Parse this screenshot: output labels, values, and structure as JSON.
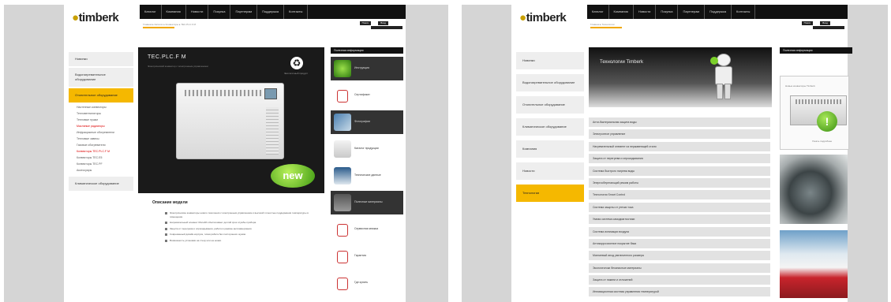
{
  "left_page": {
    "logo": {
      "brand": "timberk"
    },
    "topnav": [
      "Каталог",
      "Компания",
      "Новости",
      "Покупка",
      "Партнерам",
      "Поддержка",
      "Контакты"
    ],
    "breadcrumb": "Главная ▸ Каталог ▸ Конвекторы ▸ TEC.PLC.F M",
    "header_buttons": [
      "Поиск",
      "Вход"
    ],
    "sidebar": {
      "items": [
        {
          "label": "Новинки",
          "active": false
        },
        {
          "label": "Водонагревательное оборудование",
          "active": false
        },
        {
          "label": "Отопительное оборудование",
          "active": true
        }
      ],
      "sub_items": [
        {
          "label": "Настенные конвекторы",
          "red": false
        },
        {
          "label": "Тепловентиляторы",
          "red": false
        },
        {
          "label": "Тепловые пушки",
          "red": false
        },
        {
          "label": "Масляные радиаторы",
          "red": true
        },
        {
          "label": "Инфракрасные обогреватели",
          "red": false
        },
        {
          "label": "Тепловые завесы",
          "red": false
        },
        {
          "label": "Газовые обогреватели",
          "red": false
        },
        {
          "label": "Конвекторы TEC.PLC.F M",
          "red": true
        },
        {
          "label": "Конвекторы TEC.E5",
          "red": false
        },
        {
          "label": "Конвекторы TEC.PF",
          "red": false
        },
        {
          "label": "Аксессуары",
          "red": false
        }
      ],
      "bottom_items": [
        {
          "label": "Климатическое оборудование"
        }
      ]
    },
    "product": {
      "title": "TEC.PLC.F M",
      "subtitle": "Электрический конвектор с электронным управлением",
      "badge": "new",
      "recycle_caption": "Экологичный продукт"
    },
    "right_column": {
      "header": "Полезная информация",
      "items": [
        {
          "label": "Инструкция",
          "dark": true,
          "thumb": "green-guide"
        },
        {
          "label": "Сертификат",
          "dark": false,
          "thumb": "pdf"
        },
        {
          "label": "Фотографии",
          "dark": true,
          "thumb": "photo"
        },
        {
          "label": "Каталог продукции",
          "dark": false,
          "thumb": "heater"
        },
        {
          "label": "Технические данные",
          "dark": false,
          "thumb": "label"
        },
        {
          "label": "Полезные материалы",
          "dark": true,
          "thumb": "book"
        },
        {
          "label": "Сервисная книжка",
          "dark": false,
          "thumb": "pdf"
        },
        {
          "label": "Гарантия",
          "dark": false,
          "thumb": "pdf"
        },
        {
          "label": "Где купить",
          "dark": false,
          "thumb": "pdf"
        }
      ]
    },
    "description": {
      "title": "Описание модели",
      "bullets": [
        "Электрические конвекторы нового поколения с электронным управлением и высокой точностью поддержания температуры в помещении.",
        "Нагревательный элемент Monolith обеспечивает долгий срок службы прибора.",
        "Защита от перегрева и опрокидывания, работа в режиме антизамерзания.",
        "Современный дизайн корпуса, тихая работа без посторонних шумов.",
        "Возможность установки на стену или на ножки."
      ]
    }
  },
  "right_page": {
    "logo": {
      "brand": "timberk"
    },
    "topnav": [
      "Каталог",
      "Компания",
      "Новости",
      "Покупка",
      "Партнерам",
      "Поддержка",
      "Контакты"
    ],
    "breadcrumb": "Главная ▸ Технологии",
    "header_buttons": [
      "Поиск",
      "Вход"
    ],
    "sidebar": {
      "items": [
        {
          "label": "Новинки",
          "active": false
        },
        {
          "label": "Водонагревательное оборудование",
          "active": false
        },
        {
          "label": "Отопительное оборудование",
          "active": false
        },
        {
          "label": "Климатическое оборудование",
          "active": false
        },
        {
          "label": "Компания",
          "active": false
        },
        {
          "label": "Новости",
          "active": false
        },
        {
          "label": "Технологии",
          "active": true
        }
      ]
    },
    "banner": {
      "title": "Технологии Timberk"
    },
    "tech_list": [
      "Анти-бактериальная защита воды",
      "Электронное управление",
      "Нагревательный элемент из нержавеющей стали",
      "Защита от перегрева и опрокидывания",
      "Система быстрого нагрева воды",
      "Энергосберегающий режим работы",
      "Технология Smart Control",
      "Система защиты от утечки тока",
      "Умная система самодиагностики",
      "Система ионизации воздуха",
      "Антикоррозионное покрытие бака",
      "Магниевый анод увеличенного размера",
      "Экологически безопасные материалы",
      "Защита от накипи и отложений",
      "Инновационная система управления температурой"
    ],
    "right_column": {
      "header": "Полезная информация",
      "promo_caption_top": "Новые конвекторы Timberk",
      "promo_caption_bottom": "Узнать подробнее"
    }
  }
}
